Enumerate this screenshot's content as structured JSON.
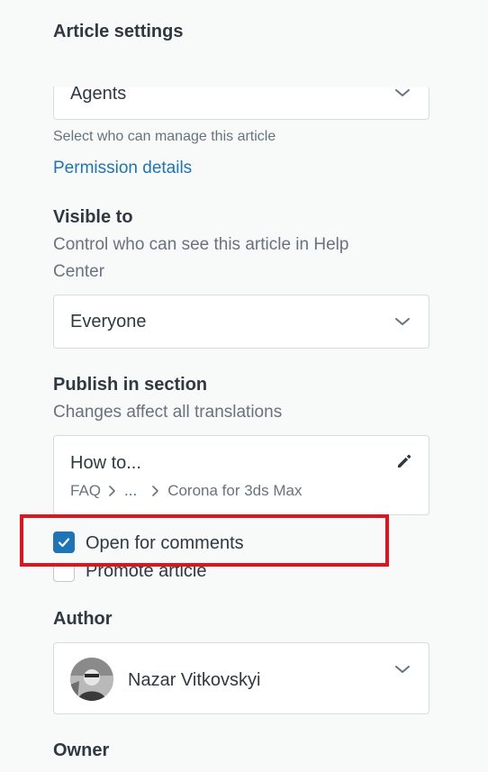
{
  "panel": {
    "title": "Article settings"
  },
  "managed_by": {
    "value": "Agents",
    "hint": "Select who can manage this article",
    "permission_link": "Permission details"
  },
  "visible_to": {
    "label": "Visible to",
    "description_line1": "Control who can see this article in Help",
    "description_line2": "Center",
    "value": "Everyone"
  },
  "publish_section": {
    "label": "Publish in section",
    "description": "Changes affect all translations",
    "section_name": "How to...",
    "breadcrumb": [
      "FAQ",
      "...",
      "Corona for 3ds Max"
    ]
  },
  "options": {
    "open_for_comments": {
      "label": "Open for comments",
      "checked": true
    },
    "promote_article": {
      "label": "Promote article",
      "checked": false
    }
  },
  "author": {
    "label": "Author",
    "name": "Nazar Vitkovskyi"
  },
  "owner": {
    "label": "Owner"
  },
  "colors": {
    "accent": "#1f73b7",
    "highlight": "#e0141e"
  }
}
